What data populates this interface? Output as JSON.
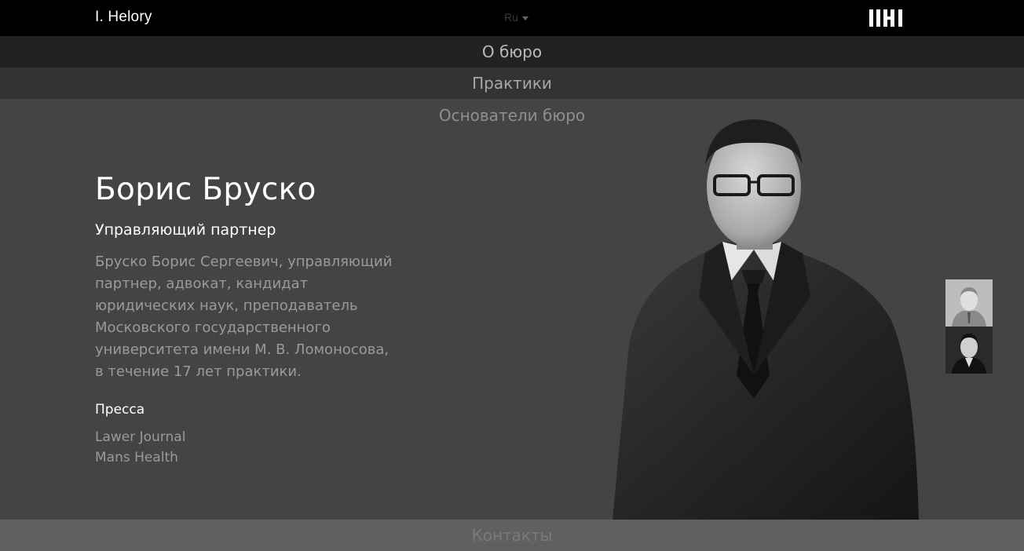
{
  "header": {
    "brand": "I. Helory",
    "language": "Ru"
  },
  "nav": {
    "about": "О бюро",
    "practices": "Практики",
    "founders": "Основатели бюро"
  },
  "profile": {
    "name": "Борис Бруско",
    "role": "Управляющий партнер",
    "bio": "Бруско Борис Сергеевич, управляющий партнер, адвокат, кандидат юридических наук, преподаватель Московского государственного университета имени М. В. Ломоносова, в течение 17 лет практики.",
    "press_title": "Пресса",
    "press": [
      "Lawer Journal",
      "Mans Health"
    ]
  },
  "footer": {
    "contacts": "Контакты"
  },
  "icons": {
    "logo": "logo-mark-icon",
    "lang_caret": "chevron-down-icon"
  },
  "colors": {
    "topbar": "#000000",
    "background": "#444444",
    "text_primary": "#ffffff",
    "text_muted": "#9a9a9a"
  }
}
